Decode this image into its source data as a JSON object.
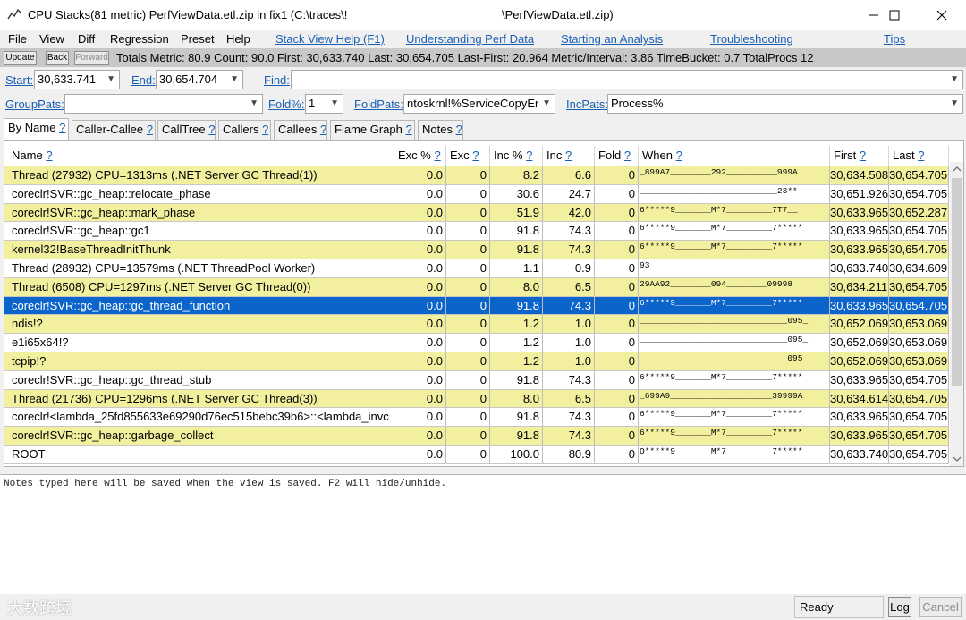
{
  "window": {
    "title_left": "CPU Stacks(81 metric) PerfViewData.etl.zip in fix1 (C:\\traces\\!",
    "title_right": "\\PerfViewData.etl.zip)"
  },
  "menu": {
    "items": [
      "File",
      "View",
      "Diff",
      "Regression",
      "Preset",
      "Help"
    ],
    "links": [
      "Stack View Help (F1)",
      "Understanding Perf Data",
      "Starting an Analysis",
      "Troubleshooting",
      "Tips"
    ]
  },
  "toolbar": {
    "update": "Update",
    "back": "Back",
    "forward": "Forward",
    "totals": "Totals Metric: 80.9  Count: 90.0  First: 30,633.740 Last: 30,654.705  Last-First: 20.964  Metric/Interval: 3.86  TimeBucket: 0.7  TotalProcs 12"
  },
  "filters": {
    "start_label": "Start:",
    "start_value": "30,633.741",
    "end_label": "End:",
    "end_value": "30,654.704",
    "find_label": "Find:",
    "find_value": "",
    "grouppats_label": "GroupPats:",
    "grouppats_value": "",
    "foldpct_label": "Fold%:",
    "foldpct_value": "1",
    "foldpats_label": "FoldPats:",
    "foldpats_value": "ntoskrnl!%ServiceCopyEr",
    "incpats_label": "IncPats:",
    "incpats_value": "Process%"
  },
  "tabs": [
    {
      "label": "By Name",
      "q": "?"
    },
    {
      "label": "Caller-Callee",
      "q": "?"
    },
    {
      "label": "CallTree",
      "q": "?"
    },
    {
      "label": "Callers",
      "q": "?"
    },
    {
      "label": "Callees",
      "q": "?"
    },
    {
      "label": "Flame Graph",
      "q": "?"
    },
    {
      "label": "Notes",
      "q": "?"
    }
  ],
  "columns": [
    "Name",
    "Exc %",
    "Exc",
    "Inc %",
    "Inc",
    "Fold",
    "When",
    "First",
    "Last"
  ],
  "col_q": "?",
  "rows": [
    {
      "name": "Thread (27932) CPU=1313ms (.NET Server GC Thread(1))",
      "exc_pct": "0.0",
      "exc": "0",
      "inc_pct": "8.2",
      "inc": "6.6",
      "fold": "0",
      "when": "_899A7________292__________999A",
      "first": "30,634.508",
      "last": "30,654.705"
    },
    {
      "name": "coreclr!SVR::gc_heap::relocate_phase",
      "exc_pct": "0.0",
      "exc": "0",
      "inc_pct": "30.6",
      "inc": "24.7",
      "fold": "0",
      "when": "___________________________23**",
      "first": "30,651.926",
      "last": "30,654.705"
    },
    {
      "name": "coreclr!SVR::gc_heap::mark_phase",
      "exc_pct": "0.0",
      "exc": "0",
      "inc_pct": "51.9",
      "inc": "42.0",
      "fold": "0",
      "when": "6*****9_______M*7_________7T7__",
      "first": "30,633.965",
      "last": "30,652.287"
    },
    {
      "name": "coreclr!SVR::gc_heap::gc1",
      "exc_pct": "0.0",
      "exc": "0",
      "inc_pct": "91.8",
      "inc": "74.3",
      "fold": "0",
      "when": "6*****9_______M*7_________7*****",
      "first": "30,633.965",
      "last": "30,654.705"
    },
    {
      "name": "kernel32!BaseThreadInitThunk",
      "exc_pct": "0.0",
      "exc": "0",
      "inc_pct": "91.8",
      "inc": "74.3",
      "fold": "0",
      "when": "6*****9_______M*7_________7*****",
      "first": "30,633.965",
      "last": "30,654.705"
    },
    {
      "name": "Thread (28932) CPU=13579ms (.NET ThreadPool Worker)",
      "exc_pct": "0.0",
      "exc": "0",
      "inc_pct": "1.1",
      "inc": "0.9",
      "fold": "0",
      "when": "93____________________________",
      "first": "30,633.740",
      "last": "30,634.609"
    },
    {
      "name": "Thread (6508) CPU=1297ms (.NET Server GC Thread(0))",
      "exc_pct": "0.0",
      "exc": "0",
      "inc_pct": "8.0",
      "inc": "6.5",
      "fold": "0",
      "when": "29AA92________094________09998",
      "first": "30,634.211",
      "last": "30,654.705"
    },
    {
      "name": "coreclr!SVR::gc_heap::gc_thread_function",
      "exc_pct": "0.0",
      "exc": "0",
      "inc_pct": "91.8",
      "inc": "74.3",
      "fold": "0",
      "when": "6*****9_______M*7_________7*****",
      "first": "30,633.965",
      "last": "30,654.705"
    },
    {
      "name": "ndis!?",
      "exc_pct": "0.0",
      "exc": "0",
      "inc_pct": "1.2",
      "inc": "1.0",
      "fold": "0",
      "when": "_____________________________095_",
      "first": "30,652.069",
      "last": "30,653.069"
    },
    {
      "name": "e1i65x64!?",
      "exc_pct": "0.0",
      "exc": "0",
      "inc_pct": "1.2",
      "inc": "1.0",
      "fold": "0",
      "when": "_____________________________095_",
      "first": "30,652.069",
      "last": "30,653.069"
    },
    {
      "name": "tcpip!?",
      "exc_pct": "0.0",
      "exc": "0",
      "inc_pct": "1.2",
      "inc": "1.0",
      "fold": "0",
      "when": "_____________________________095_",
      "first": "30,652.069",
      "last": "30,653.069"
    },
    {
      "name": "coreclr!SVR::gc_heap::gc_thread_stub",
      "exc_pct": "0.0",
      "exc": "0",
      "inc_pct": "91.8",
      "inc": "74.3",
      "fold": "0",
      "when": "6*****9_______M*7_________7*****",
      "first": "30,633.965",
      "last": "30,654.705"
    },
    {
      "name": "Thread (21736) CPU=1296ms (.NET Server GC Thread(3))",
      "exc_pct": "0.0",
      "exc": "0",
      "inc_pct": "8.0",
      "inc": "6.5",
      "fold": "0",
      "when": "_699A9____________________39999A",
      "first": "30,634.614",
      "last": "30,654.705"
    },
    {
      "name": "coreclr!<lambda_25fd855633e69290d76ec515bebc39b6>::<lambda_invc",
      "exc_pct": "0.0",
      "exc": "0",
      "inc_pct": "91.8",
      "inc": "74.3",
      "fold": "0",
      "when": "6*****9_______M*7_________7*****",
      "first": "30,633.965",
      "last": "30,654.705"
    },
    {
      "name": "coreclr!SVR::gc_heap::garbage_collect",
      "exc_pct": "0.0",
      "exc": "0",
      "inc_pct": "91.8",
      "inc": "74.3",
      "fold": "0",
      "when": "6*****9_______M*7_________7*****",
      "first": "30,633.965",
      "last": "30,654.705"
    },
    {
      "name": "ROOT",
      "exc_pct": "0.0",
      "exc": "0",
      "inc_pct": "100.0",
      "inc": "80.9",
      "fold": "0",
      "when": "O*****9_______M*7_________7*****",
      "first": "30,633.740",
      "last": "30,654.705"
    }
  ],
  "selected_row": 7,
  "notes_text": "Notes typed here will be saved when the view is saved. F2 will hide/unhide.",
  "status": {
    "ready": "Ready",
    "log": "Log",
    "cancel": "Cancel"
  },
  "watermark": "大数跨境",
  "colors": {
    "row_highlight": "#f2ef9e",
    "selection": "#0a64c9",
    "link": "#1a5fb4"
  }
}
